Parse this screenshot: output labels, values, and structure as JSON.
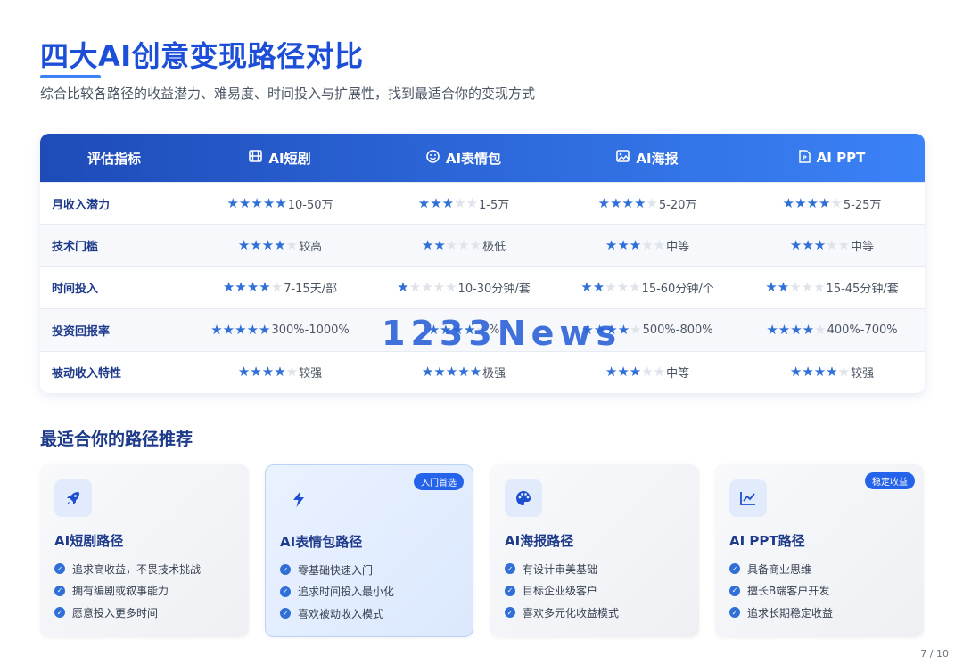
{
  "header": {
    "title": "四大AI创意变现路径对比",
    "subtitle": "综合比较各路径的收益潜力、难易度、时间投入与扩展性，找到最适合你的变现方式"
  },
  "table": {
    "headers": [
      {
        "label": "评估指标",
        "icon": ""
      },
      {
        "label": "AI短剧",
        "icon": "film-icon"
      },
      {
        "label": "AI表情包",
        "icon": "smile-icon"
      },
      {
        "label": "AI海报",
        "icon": "image-icon"
      },
      {
        "label": "AI PPT",
        "icon": "ppt-file-icon"
      }
    ],
    "rows": [
      {
        "label": "月收入潜力",
        "cells": [
          {
            "stars": 5,
            "text": "10-50万"
          },
          {
            "stars": 3,
            "text": "1-5万"
          },
          {
            "stars": 4,
            "text": "5-20万"
          },
          {
            "stars": 4,
            "text": "5-25万"
          }
        ]
      },
      {
        "label": "技术门槛",
        "cells": [
          {
            "stars": 4,
            "text": "较高"
          },
          {
            "stars": 2,
            "text": "极低"
          },
          {
            "stars": 3,
            "text": "中等"
          },
          {
            "stars": 3,
            "text": "中等"
          }
        ]
      },
      {
        "label": "时间投入",
        "cells": [
          {
            "stars": 4,
            "text": "7-15天/部"
          },
          {
            "stars": 1,
            "text": "10-30分钟/套"
          },
          {
            "stars": 2,
            "text": "15-60分钟/个"
          },
          {
            "stars": 2,
            "text": "15-45分钟/套"
          }
        ]
      },
      {
        "label": "投资回报率",
        "cells": [
          {
            "stars": 5,
            "text": "300%-1000%"
          },
          {
            "stars": 4,
            "text": "%"
          },
          {
            "stars": 4,
            "text": "500%-800%"
          },
          {
            "stars": 4,
            "text": "400%-700%"
          }
        ]
      },
      {
        "label": "被动收入特性",
        "cells": [
          {
            "stars": 4,
            "text": "较强"
          },
          {
            "stars": 5,
            "text": "极强"
          },
          {
            "stars": 3,
            "text": "中等"
          },
          {
            "stars": 4,
            "text": "较强"
          }
        ]
      }
    ]
  },
  "watermark": "1233News",
  "recommend": {
    "title": "最适合你的路径推荐",
    "cards": [
      {
        "icon": "rocket-icon",
        "title": "AI短剧路径",
        "badge": "",
        "items": [
          "追求高收益，不畏技术挑战",
          "拥有编剧或叙事能力",
          "愿意投入更多时间"
        ]
      },
      {
        "icon": "lightning-icon",
        "title": "AI表情包路径",
        "badge": "入门首选",
        "items": [
          "零基础快速入门",
          "追求时间投入最小化",
          "喜欢被动收入模式"
        ]
      },
      {
        "icon": "palette-icon",
        "title": "AI海报路径",
        "badge": "",
        "items": [
          "有设计审美基础",
          "目标企业级客户",
          "喜欢多元化收益模式"
        ]
      },
      {
        "icon": "chart-line-icon",
        "title": "AI PPT路径",
        "badge": "稳定收益",
        "items": [
          "具备商业思维",
          "擅长B端客户开发",
          "追求长期稳定收益"
        ]
      }
    ]
  },
  "footer": {
    "page": "7 / 10"
  },
  "colors": {
    "accent": "#1d4ed8",
    "star_on": "#2f6fd6",
    "star_off": "#dfe3ea",
    "header_start": "#1e4bb8",
    "header_end": "#3b82f6"
  }
}
